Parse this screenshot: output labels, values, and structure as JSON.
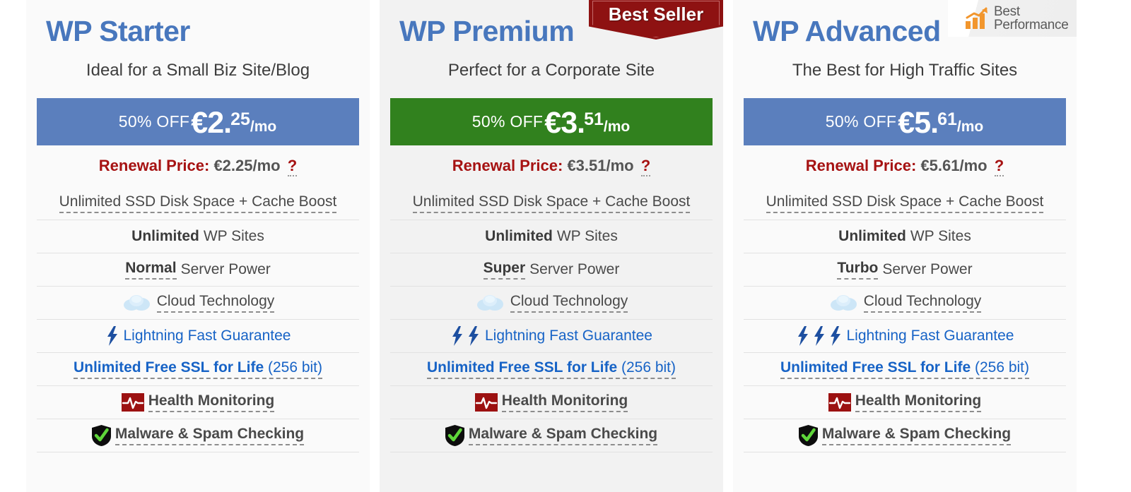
{
  "plans": [
    {
      "id": "wp-starter",
      "title": "WP Starter",
      "subtitle": "Ideal for a Small Biz Site/Blog",
      "band_color": "#5b7fbd",
      "price": {
        "off_label": "50% OFF",
        "currency_amount": "€2.",
        "cents": "25",
        "period": "/mo"
      },
      "renewal": {
        "label": "Renewal Price:",
        "value": "€2.25/mo",
        "help": "?"
      },
      "features": {
        "disk": "Unlimited SSD Disk Space + Cache Boost",
        "sites_bold": "Unlimited",
        "sites_rest": "WP Sites",
        "power_bold": "Normal",
        "power_rest": "Server Power",
        "cloud": "Cloud Technology",
        "lightning": "Lightning Fast Guarantee",
        "bolt_count": 1,
        "ssl_bold": "Unlimited Free SSL for Life",
        "ssl_rest": "(256 bit)",
        "health": "Health Monitoring",
        "malware": "Malware & Spam Checking"
      }
    },
    {
      "id": "wp-premium",
      "title": "WP Premium",
      "subtitle": "Perfect for a Corporate Site",
      "band_color": "#31811e",
      "badge": "Best Seller",
      "price": {
        "off_label": "50% OFF",
        "currency_amount": "€3.",
        "cents": "51",
        "period": "/mo"
      },
      "renewal": {
        "label": "Renewal Price:",
        "value": "€3.51/mo",
        "help": "?"
      },
      "features": {
        "disk": "Unlimited SSD Disk Space + Cache Boost",
        "sites_bold": "Unlimited",
        "sites_rest": "WP Sites",
        "power_bold": "Super",
        "power_rest": "Server Power",
        "cloud": "Cloud Technology",
        "lightning": "Lightning Fast Guarantee",
        "bolt_count": 2,
        "ssl_bold": "Unlimited Free SSL for Life",
        "ssl_rest": "(256 bit)",
        "health": "Health Monitoring",
        "malware": "Malware & Spam Checking"
      }
    },
    {
      "id": "wp-advanced",
      "title": "WP Advanced",
      "subtitle": "The Best for High Traffic Sites",
      "band_color": "#5b7fbd",
      "badge_performance": {
        "line1": "Best",
        "line2": "Performance"
      },
      "price": {
        "off_label": "50% OFF",
        "currency_amount": "€5.",
        "cents": "61",
        "period": "/mo"
      },
      "renewal": {
        "label": "Renewal Price:",
        "value": "€5.61/mo",
        "help": "?"
      },
      "features": {
        "disk": "Unlimited SSD Disk Space + Cache Boost",
        "sites_bold": "Unlimited",
        "sites_rest": "WP Sites",
        "power_bold": "Turbo",
        "power_rest": "Server Power",
        "cloud": "Cloud Technology",
        "lightning": "Lightning Fast Guarantee",
        "bolt_count": 3,
        "ssl_bold": "Unlimited Free SSL for Life",
        "ssl_rest": "(256 bit)",
        "health": "Health Monitoring",
        "malware": "Malware & Spam Checking"
      }
    }
  ],
  "colors": {
    "title_blue": "#4877bd",
    "band_blue": "#5b7fbd",
    "band_green": "#31811e",
    "renewal_red": "#a61212",
    "link_blue": "#1763c6",
    "badge_red": "#8e1212",
    "perf_orange": "#f2962d"
  }
}
